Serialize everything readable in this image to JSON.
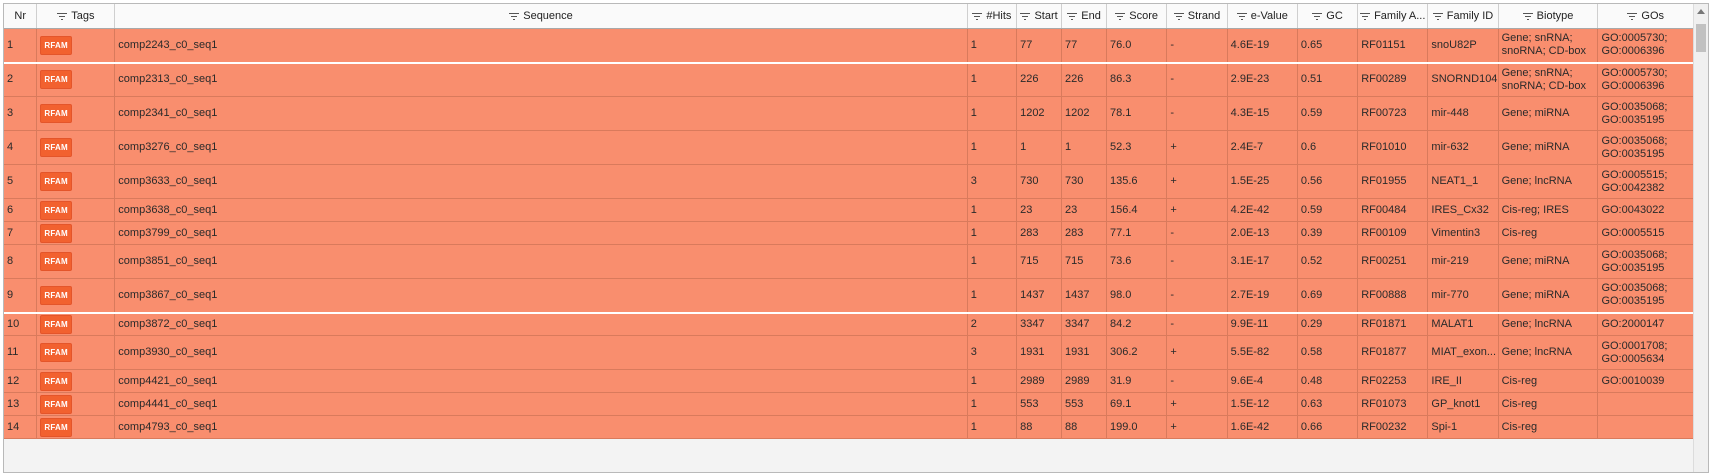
{
  "columns": [
    {
      "key": "nr",
      "label": "Nr",
      "filter": false
    },
    {
      "key": "tags",
      "label": "Tags",
      "filter": true
    },
    {
      "key": "sequence",
      "label": "Sequence",
      "filter": true
    },
    {
      "key": "hits",
      "label": "#Hits",
      "filter": true
    },
    {
      "key": "start",
      "label": "Start",
      "filter": true
    },
    {
      "key": "end",
      "label": "End",
      "filter": true
    },
    {
      "key": "score",
      "label": "Score",
      "filter": true
    },
    {
      "key": "strand",
      "label": "Strand",
      "filter": true
    },
    {
      "key": "evalue",
      "label": "e-Value",
      "filter": true
    },
    {
      "key": "gc",
      "label": "GC",
      "filter": true
    },
    {
      "key": "family_acc",
      "label": "Family A...",
      "filter": true
    },
    {
      "key": "family_id",
      "label": "Family ID",
      "filter": true
    },
    {
      "key": "biotype",
      "label": "Biotype",
      "filter": true
    },
    {
      "key": "gos",
      "label": "GOs",
      "filter": true
    }
  ],
  "tag_label": "RFAM",
  "colors": {
    "row": "#f98e6e",
    "tag": "#f2612f"
  },
  "rows": [
    {
      "nr": "1",
      "sequence": "comp2243_c0_seq1",
      "hits": "1",
      "start": "77",
      "end": "77",
      "score": "76.0",
      "strand": "-",
      "evalue": "4.6E-19",
      "gc": "0.65",
      "family_acc": "RF01151",
      "family_id": "snoU82P",
      "biotype": "Gene; snRNA; snoRNA; CD-box",
      "gos": "GO:0005730; GO:0006396",
      "tall": true,
      "sel": true
    },
    {
      "nr": "2",
      "sequence": "comp2313_c0_seq1",
      "hits": "1",
      "start": "226",
      "end": "226",
      "score": "86.3",
      "strand": "-",
      "evalue": "2.9E-23",
      "gc": "0.51",
      "family_acc": "RF00289",
      "family_id": "SNORND104",
      "biotype": "Gene; snRNA; snoRNA; CD-box",
      "gos": "GO:0005730; GO:0006396",
      "tall": true
    },
    {
      "nr": "3",
      "sequence": "comp2341_c0_seq1",
      "hits": "1",
      "start": "1202",
      "end": "1202",
      "score": "78.1",
      "strand": "-",
      "evalue": "4.3E-15",
      "gc": "0.59",
      "family_acc": "RF00723",
      "family_id": "mir-448",
      "biotype": "Gene; miRNA",
      "gos": "GO:0035068; GO:0035195",
      "tall": true
    },
    {
      "nr": "4",
      "sequence": "comp3276_c0_seq1",
      "hits": "1",
      "start": "1",
      "end": "1",
      "score": "52.3",
      "strand": "+",
      "evalue": "2.4E-7",
      "gc": "0.6",
      "family_acc": "RF01010",
      "family_id": "mir-632",
      "biotype": "Gene; miRNA",
      "gos": "GO:0035068; GO:0035195",
      "tall": true
    },
    {
      "nr": "5",
      "sequence": "comp3633_c0_seq1",
      "hits": "3",
      "start": "730",
      "end": "730",
      "score": "135.6",
      "strand": "+",
      "evalue": "1.5E-25",
      "gc": "0.56",
      "family_acc": "RF01955",
      "family_id": "NEAT1_1",
      "biotype": "Gene; lncRNA",
      "gos": "GO:0005515; GO:0042382",
      "tall": true
    },
    {
      "nr": "6",
      "sequence": "comp3638_c0_seq1",
      "hits": "1",
      "start": "23",
      "end": "23",
      "score": "156.4",
      "strand": "+",
      "evalue": "4.2E-42",
      "gc": "0.59",
      "family_acc": "RF00484",
      "family_id": "IRES_Cx32",
      "biotype": "Cis-reg; IRES",
      "gos": "GO:0043022",
      "tall": false
    },
    {
      "nr": "7",
      "sequence": "comp3799_c0_seq1",
      "hits": "1",
      "start": "283",
      "end": "283",
      "score": "77.1",
      "strand": "-",
      "evalue": "2.0E-13",
      "gc": "0.39",
      "family_acc": "RF00109",
      "family_id": "Vimentin3",
      "biotype": "Cis-reg",
      "gos": "GO:0005515",
      "tall": false
    },
    {
      "nr": "8",
      "sequence": "comp3851_c0_seq1",
      "hits": "1",
      "start": "715",
      "end": "715",
      "score": "73.6",
      "strand": "-",
      "evalue": "3.1E-17",
      "gc": "0.52",
      "family_acc": "RF00251",
      "family_id": "mir-219",
      "biotype": "Gene; miRNA",
      "gos": "GO:0035068; GO:0035195",
      "tall": true
    },
    {
      "nr": "9",
      "sequence": "comp3867_c0_seq1",
      "hits": "1",
      "start": "1437",
      "end": "1437",
      "score": "98.0",
      "strand": "-",
      "evalue": "2.7E-19",
      "gc": "0.69",
      "family_acc": "RF00888",
      "family_id": "mir-770",
      "biotype": "Gene; miRNA",
      "gos": "GO:0035068; GO:0035195",
      "tall": true,
      "sel": true
    },
    {
      "nr": "10",
      "sequence": "comp3872_c0_seq1",
      "hits": "2",
      "start": "3347",
      "end": "3347",
      "score": "84.2",
      "strand": "-",
      "evalue": "9.9E-11",
      "gc": "0.29",
      "family_acc": "RF01871",
      "family_id": "MALAT1",
      "biotype": "Gene; lncRNA",
      "gos": "GO:2000147",
      "tall": false
    },
    {
      "nr": "11",
      "sequence": "comp3930_c0_seq1",
      "hits": "3",
      "start": "1931",
      "end": "1931",
      "score": "306.2",
      "strand": "+",
      "evalue": "5.5E-82",
      "gc": "0.58",
      "family_acc": "RF01877",
      "family_id": "MIAT_exon...",
      "biotype": "Gene; lncRNA",
      "gos": "GO:0001708; GO:0005634",
      "tall": true
    },
    {
      "nr": "12",
      "sequence": "comp4421_c0_seq1",
      "hits": "1",
      "start": "2989",
      "end": "2989",
      "score": "31.9",
      "strand": "-",
      "evalue": "9.6E-4",
      "gc": "0.48",
      "family_acc": "RF02253",
      "family_id": "IRE_II",
      "biotype": "Cis-reg",
      "gos": "GO:0010039",
      "tall": false
    },
    {
      "nr": "13",
      "sequence": "comp4441_c0_seq1",
      "hits": "1",
      "start": "553",
      "end": "553",
      "score": "69.1",
      "strand": "+",
      "evalue": "1.5E-12",
      "gc": "0.63",
      "family_acc": "RF01073",
      "family_id": "GP_knot1",
      "biotype": "Cis-reg",
      "gos": "",
      "tall": false
    },
    {
      "nr": "14",
      "sequence": "comp4793_c0_seq1",
      "hits": "1",
      "start": "88",
      "end": "88",
      "score": "199.0",
      "strand": "+",
      "evalue": "1.6E-42",
      "gc": "0.66",
      "family_acc": "RF00232",
      "family_id": "Spi-1",
      "biotype": "Cis-reg",
      "gos": "",
      "tall": false
    }
  ]
}
